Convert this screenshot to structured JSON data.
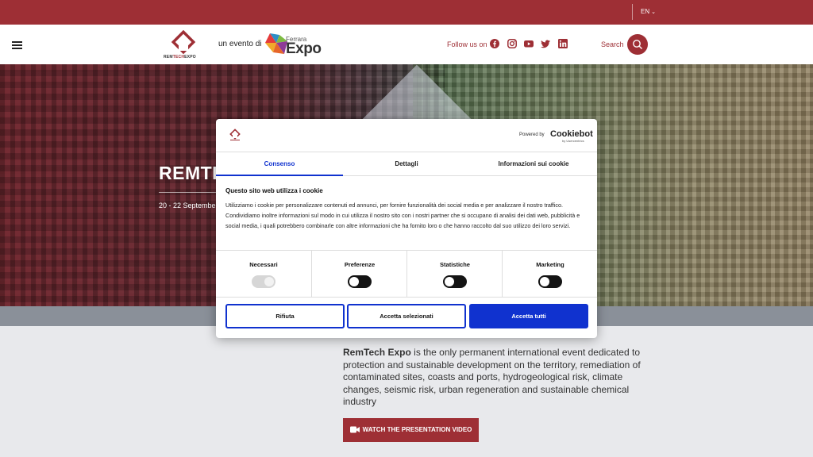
{
  "topbar": {
    "language": "EN"
  },
  "header": {
    "logo_text_main": "REM",
    "logo_text_red": "TECH",
    "logo_text_end": "EXPO",
    "event_label": "un evento di",
    "partner_small": "Ferrara",
    "partner_big": "Expo",
    "follow_label": "Follow us on",
    "search_label": "Search",
    "social_icons": [
      "facebook-icon",
      "instagram-icon",
      "youtube-icon",
      "twitter-icon",
      "linkedin-icon"
    ]
  },
  "hero": {
    "title": "REMTE",
    "dates": "20 - 22 September"
  },
  "about": {
    "brand": "RemTech Expo",
    "text": " is the only permanent international event dedicated to protection and sustainable development on the territory, remediation of contaminated sites, coasts and ports, hydrogeological risk, climate changes, seismic risk, urban regeneration and sustainable chemical industry",
    "video_button": "WATCH THE PRESENTATION VIDEO"
  },
  "cookie_modal": {
    "powered_by": "Powered by",
    "provider": "Cookiebot",
    "provider_sub": "by Usercentrics",
    "tabs": [
      {
        "label": "Consenso",
        "active": true
      },
      {
        "label": "Dettagli",
        "active": false
      },
      {
        "label": "Informazioni sui cookie",
        "active": false
      }
    ],
    "title": "Questo sito web utilizza i cookie",
    "body": "Utilizziamo i cookie per personalizzare contenuti ed annunci, per fornire funzionalità dei social media e per analizzare il nostro traffico. Condividiamo inoltre informazioni sul modo in cui utilizza il nostro sito con i nostri partner che si occupano di analisi dei dati web, pubblicità e social media, i quali potrebbero combinarle con altre informazioni che ha fornito loro o che hanno raccolto dal suo utilizzo dei loro servizi.",
    "categories": [
      {
        "label": "Necessari",
        "enabled": true,
        "disabled": true
      },
      {
        "label": "Preferenze",
        "enabled": false,
        "disabled": false
      },
      {
        "label": "Statistiche",
        "enabled": false,
        "disabled": false
      },
      {
        "label": "Marketing",
        "enabled": false,
        "disabled": false
      }
    ],
    "buttons": {
      "reject": "Rifiuta",
      "accept_selected": "Accetta selezionati",
      "accept_all": "Accetta tutti"
    }
  },
  "colors": {
    "brand_red": "#9e2f35",
    "cookiebot_blue": "#1032cf"
  }
}
